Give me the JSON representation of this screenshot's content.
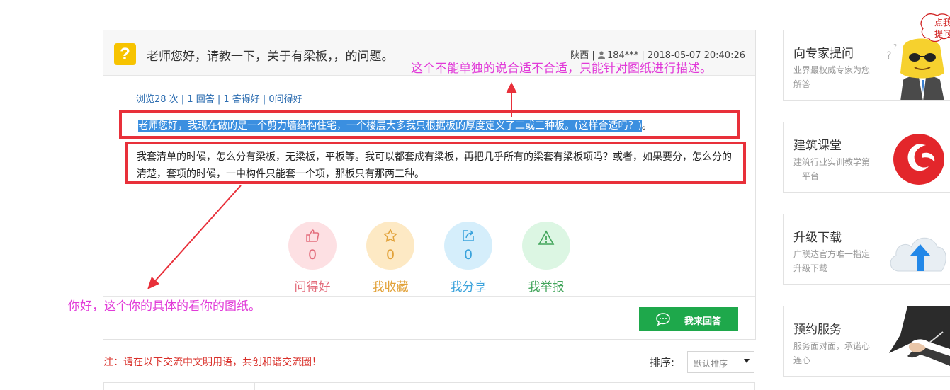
{
  "question": {
    "title": "老师您好，请教一下，关于有梁板，，的问题。",
    "region": "陕西",
    "user": "184***",
    "datetime": "2018-05-07 20:40:26",
    "stats": "浏览28 次 | 1 回答 | 1 答得好 | 0问得好",
    "body_highlighted": "老师您好，我现在做的是一个剪力墙结构住宅，一个楼层大多我只根据板的厚度定义了二或三种板。(这样合适吗？)",
    "body_highlighted_tail": "。",
    "body_second": "我套清单的时候，怎么分有梁板，无梁板，平板等。我可以都套成有梁板，再把几乎所有的梁套有梁板项吗？或者，如果要分，怎么分的清楚，套项的时候，一中构件只能套一个项，那板只有那两三种。"
  },
  "actions": [
    {
      "count": "0",
      "label": "问得好",
      "icon": "thumbs-up-icon"
    },
    {
      "count": "0",
      "label": "我收藏",
      "icon": "star-icon"
    },
    {
      "count": "0",
      "label": "我分享",
      "icon": "share-icon"
    },
    {
      "count": "0",
      "label": "我举报",
      "icon": "warning-icon"
    }
  ],
  "answer_button": "我来回答",
  "annotations": {
    "top": "这个不能单独的说合适不合适，只能针对图纸进行描述。",
    "bottom": "你好，这个你的具体的看你的图纸。"
  },
  "notice": "注：请在以下交流中文明用语，共创和谐交流圈！",
  "sort": {
    "label": "排序:",
    "value": "默认排序"
  },
  "sidebar": [
    {
      "title": "向专家提问",
      "desc": "业界最权威专家为您解答",
      "icon": "expert-mascot-icon"
    },
    {
      "title": "建筑课堂",
      "desc": "建筑行业实训教学第一平台",
      "icon": "classroom-logo-icon"
    },
    {
      "title": "升级下载",
      "desc": "广联达官方唯一指定升级下载",
      "icon": "cloud-upload-icon"
    },
    {
      "title": "预约服务",
      "desc": "服务面对面，承诺心连心",
      "icon": "handshake-icon"
    }
  ],
  "bubble": {
    "line1": "点我",
    "line2": "提问"
  },
  "colors": {
    "highlight": "#3b8fe0",
    "annotation": "#e13ad8",
    "box_border": "#e8303a",
    "answer_button": "#1ea84b",
    "question_mark": "#f7c300"
  }
}
